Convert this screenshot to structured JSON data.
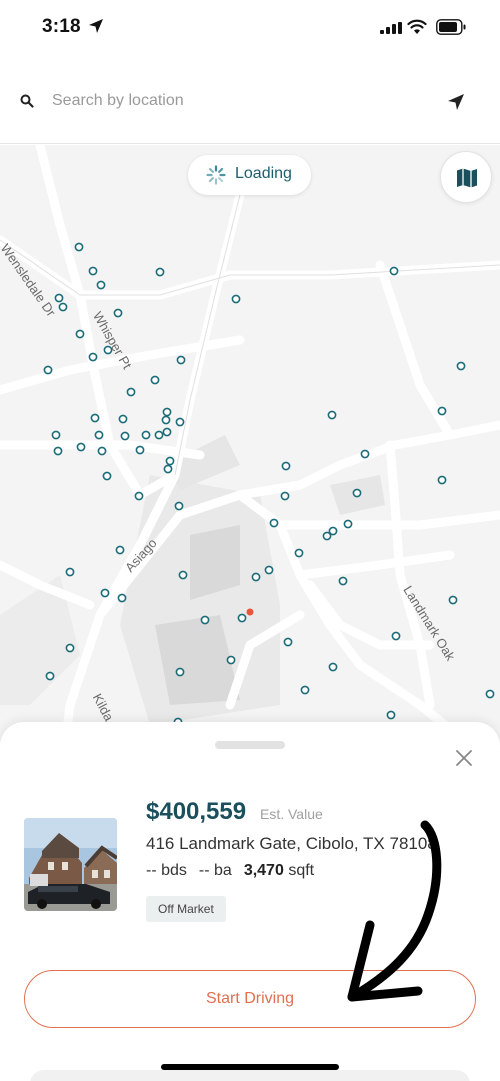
{
  "status_bar": {
    "time": "3:18",
    "icons": [
      "location-arrow-icon",
      "cellular-signal-icon",
      "wifi-icon",
      "battery-icon"
    ]
  },
  "search": {
    "placeholder": "Search by location",
    "value": "",
    "icons": [
      "search-icon",
      "navigation-arrow-icon"
    ]
  },
  "map": {
    "loading_text": "Loading",
    "streets": [
      "Wensledale Dr",
      "Whisper Pt",
      "Asiago",
      "Landmark Oak",
      "Kilda"
    ],
    "toggle_icon": "folded-map-icon"
  },
  "property": {
    "price": "$400,559",
    "price_label": "Est. Value",
    "address": "416 Landmark Gate, Cibolo, TX 78108",
    "beds": "-- bds",
    "baths": "-- ba",
    "sqft_value": "3,470",
    "sqft_unit": "sqft",
    "status_badge": "Off Market"
  },
  "actions": {
    "start_driving": "Start Driving"
  },
  "colors": {
    "accent": "#e07050",
    "brand_teal": "#1b4f5c",
    "marker": "#1b6b78",
    "selected_marker": "#e8553a"
  }
}
